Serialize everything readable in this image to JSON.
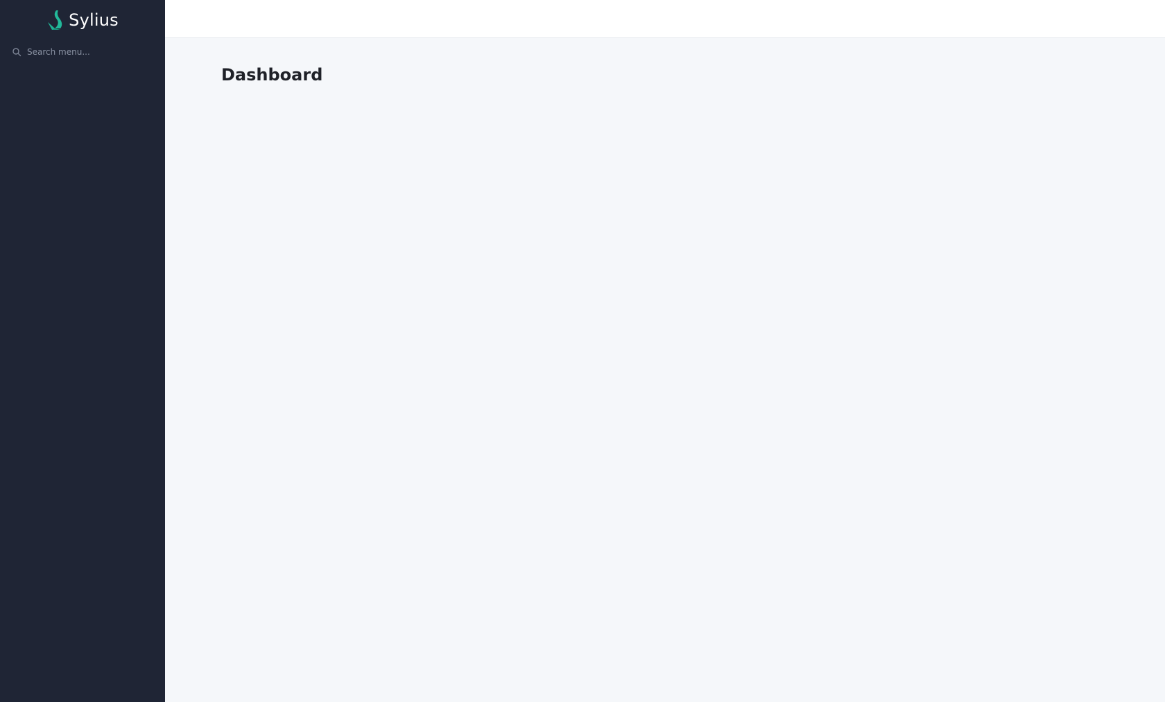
{
  "brand": {
    "name": "Sylius",
    "accent_color": "#22b99a"
  },
  "sidebar": {
    "search": {
      "placeholder": "Search menu...",
      "value": ""
    },
    "background": "#1f2535"
  },
  "main": {
    "title": "Dashboard"
  }
}
